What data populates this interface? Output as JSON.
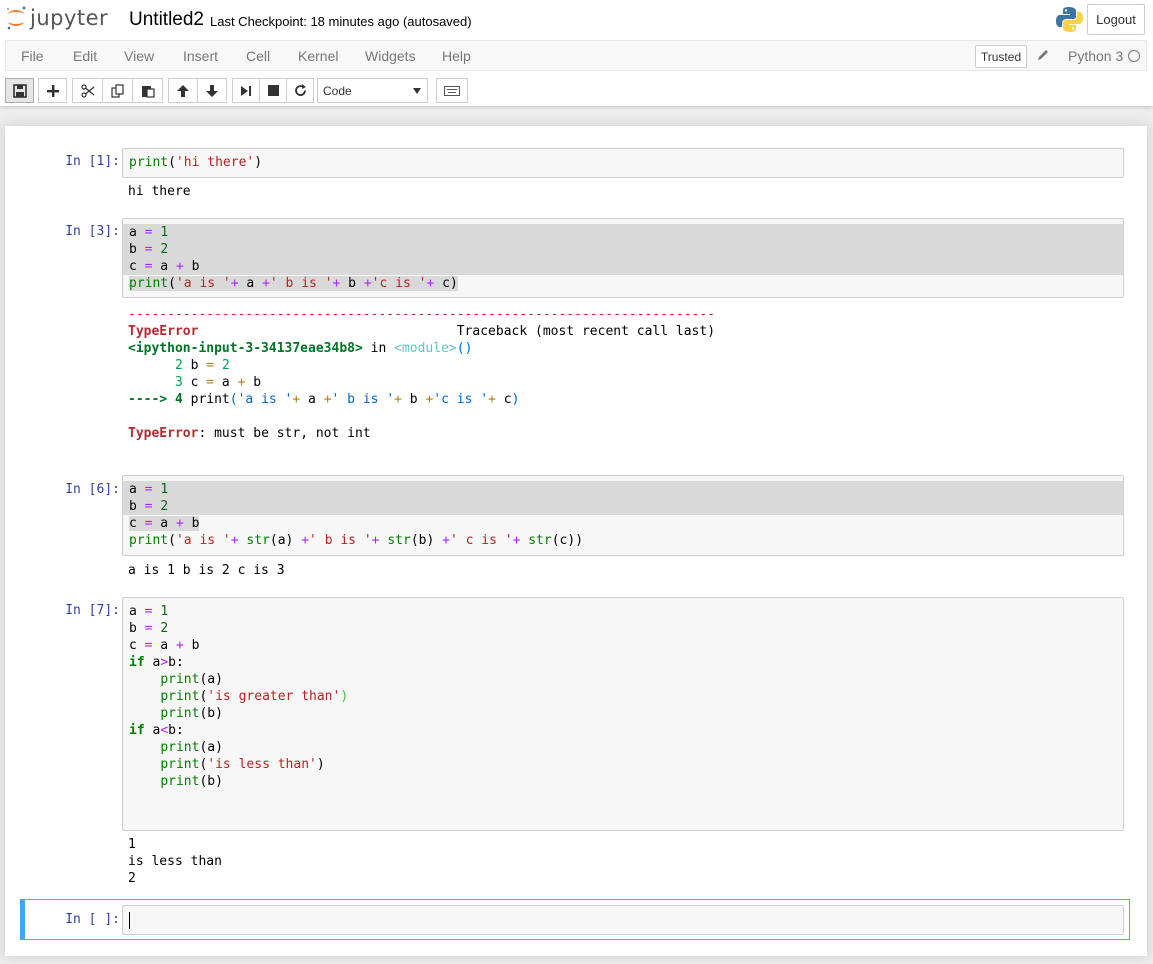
{
  "header": {
    "brand": "jupyter",
    "notebook_name": "Untitled2",
    "checkpoint": "Last Checkpoint: 18 minutes ago (autosaved)",
    "logout_label": "Logout",
    "brand_color": "#f37726"
  },
  "menubar": {
    "items": [
      "File",
      "Edit",
      "View",
      "Insert",
      "Cell",
      "Kernel",
      "Widgets",
      "Help"
    ],
    "trusted_label": "Trusted",
    "kernel_name": "Python 3"
  },
  "toolbar": {
    "icons": [
      "save-icon",
      "plus-icon",
      "cut-icon",
      "copy-icon",
      "paste-icon",
      "arrow-up-icon",
      "arrow-down-icon",
      "run-icon",
      "stop-icon",
      "restart-icon",
      "keyboard-icon"
    ],
    "cell_type": "Code"
  },
  "cells": [
    {
      "prompt": "In [1]:",
      "output": "hi there"
    },
    {
      "prompt": "In [3]:",
      "traceback": {
        "dashes": "---------------------------------------------------------------------------",
        "error_name": "TypeError",
        "traceback_label": "Traceback (most recent call last)",
        "input_ref": "<ipython-input-3-34137eae34b8>",
        "in_word": " in ",
        "module": "<module>",
        "parens": "()",
        "final_error": "TypeError",
        "final_msg": ": must be str, not int"
      }
    },
    {
      "prompt": "In [6]:",
      "output": "a is 1 b is 2 c is 3"
    },
    {
      "prompt": "In [7]:",
      "output_lines": [
        "1",
        "is less than",
        "2"
      ]
    },
    {
      "prompt": "In [ ]:"
    }
  ]
}
